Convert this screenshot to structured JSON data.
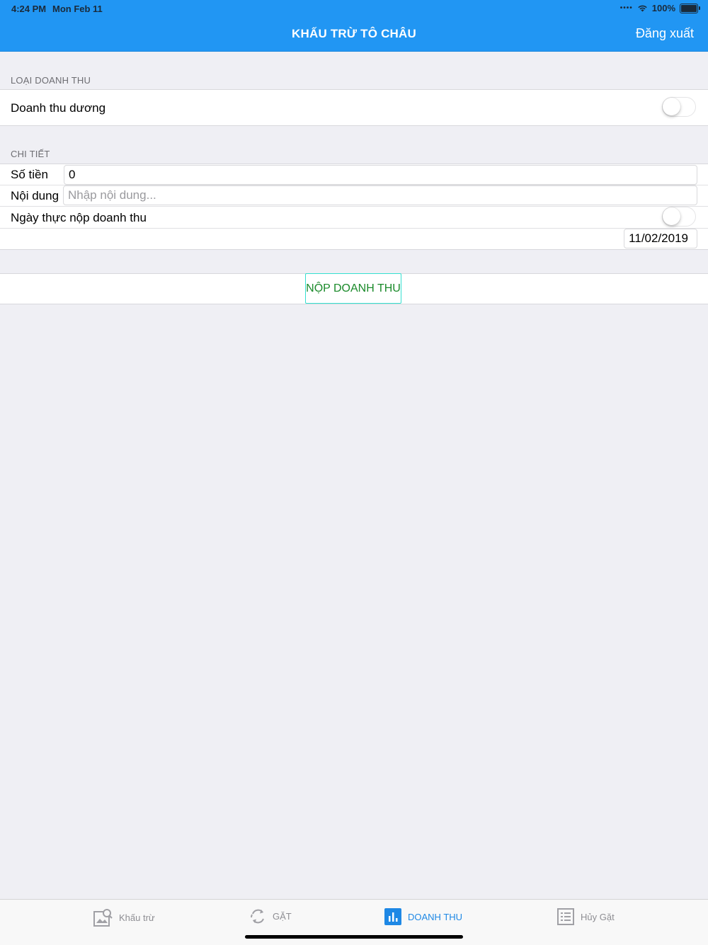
{
  "status_bar": {
    "time": "4:24 PM",
    "date": "Mon Feb 11",
    "battery": "100%"
  },
  "nav": {
    "title": "KHẤU TRỪ TÔ CHÂU",
    "logout_label": "Đăng xuất"
  },
  "revenue_type": {
    "header": "LOẠI DOANH THU",
    "positive_label": "Doanh thu dương",
    "positive_on": false
  },
  "details": {
    "header": "CHI TIẾT",
    "amount_label": "Số tiền",
    "amount_value": "0",
    "content_label": "Nội dung",
    "content_placeholder": "Nhập nội dung...",
    "actual_date_label": "Ngày thực nộp doanh thu",
    "actual_date_on": false,
    "date_value": "11/02/2019"
  },
  "submit_label": "NỘP DOANH THU",
  "tabs": [
    {
      "label": "Khấu trừ",
      "icon": "image-search-icon"
    },
    {
      "label": "GẶT",
      "icon": "refresh-icon"
    },
    {
      "label": "DOANH THU",
      "icon": "bar-chart-icon",
      "active": true
    },
    {
      "label": "Hủy Gặt",
      "icon": "list-icon"
    }
  ],
  "colors": {
    "nav": "#2196f3",
    "active_tab": "#1e88e5",
    "submit_text": "#1a8a2a",
    "submit_border": "#35e0d0"
  }
}
